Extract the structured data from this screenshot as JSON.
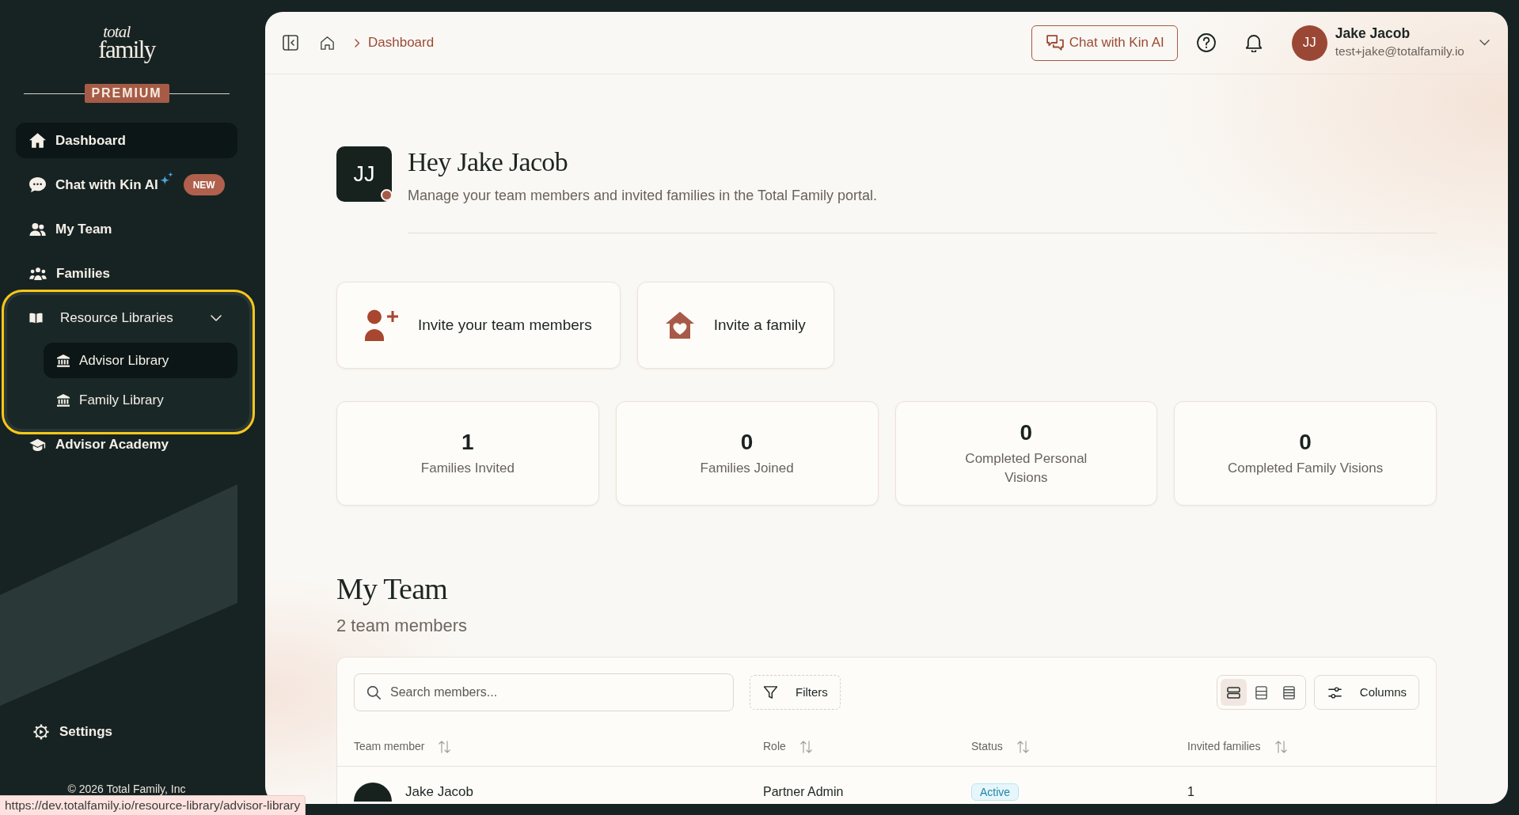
{
  "sidebar": {
    "logo": {
      "line_1": "total",
      "line_2": "family"
    },
    "plan_badge": "PREMIUM",
    "nav": [
      {
        "label": "Dashboard",
        "selected": true
      },
      {
        "label": "Chat with Kin AI",
        "badge": "NEW",
        "selected": false
      },
      {
        "label": "My Team",
        "selected": false
      },
      {
        "label": "Families",
        "selected": false
      },
      {
        "label": "Resource Libraries",
        "selected": false,
        "expanded": true,
        "focused": true,
        "children": [
          {
            "label": "Advisor Library",
            "selected": true
          },
          {
            "label": "Family Library",
            "selected": false
          }
        ]
      },
      {
        "label": "Advisor Academy",
        "selected": false
      }
    ],
    "settings": {
      "label": "Settings"
    },
    "copyright": "© 2026 Total Family, Inc"
  },
  "status_url": "https://dev.totalfamily.io/resource-library/advisor-library",
  "topbar": {
    "breadcrumb": [
      "Dashboard"
    ],
    "chat_button": "Chat with Kin AI",
    "user": {
      "initials": "JJ",
      "name": "Jake Jacob",
      "email": "test+jake@totalfamily.io"
    }
  },
  "greeting": {
    "initials": "JJ",
    "title": "Hey Jake Jacob",
    "subtitle": "Manage your team members and invited families in the Total Family portal."
  },
  "actions": [
    {
      "label": "Invite your team members"
    },
    {
      "label": "Invite a family"
    }
  ],
  "stats": [
    {
      "value": "1",
      "label": "Families Invited"
    },
    {
      "value": "0",
      "label": "Families Joined"
    },
    {
      "value": "0",
      "label": "Completed Personal Visions"
    },
    {
      "value": "0",
      "label": "Completed Family Visions"
    }
  ],
  "team": {
    "title": "My Team",
    "subtitle": "2 team members",
    "search": {
      "placeholder": "Search members..."
    },
    "filters_button": "Filters",
    "views": [
      {
        "selected": true
      },
      {
        "selected": false
      },
      {
        "selected": false
      }
    ],
    "columns_button": "Columns",
    "columns": [
      "Team member",
      "Role",
      "Status",
      "Invited families"
    ],
    "rows": [
      {
        "name": "Jake Jacob",
        "role": "Partner Admin",
        "status": "Active",
        "invited_families": "1"
      }
    ]
  }
}
